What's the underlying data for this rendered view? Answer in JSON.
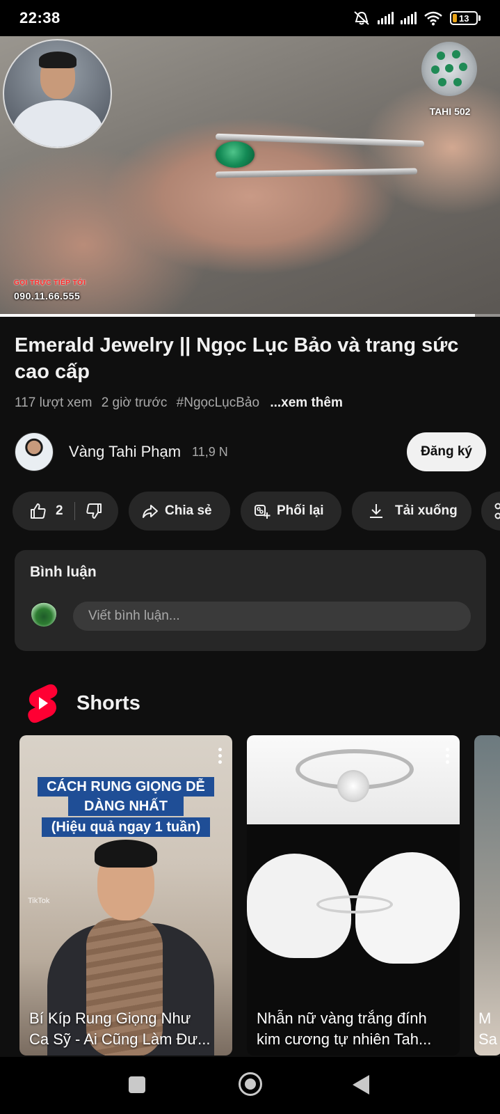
{
  "status_bar": {
    "time": "22:38",
    "battery": "13",
    "icons": [
      "mute-icon",
      "signal-icon",
      "signal-icon",
      "wifi-icon",
      "battery-icon"
    ]
  },
  "video": {
    "logo_text": "TAHI 502",
    "hotline_label": "GỌI TRỰC TIẾP TỚI",
    "hotline_number": "090.11.66.555",
    "progress": 0.95
  },
  "title": "Emerald Jewelry || Ngọc Lục Bảo và trang sức cao cấp",
  "meta": {
    "views": "117 lượt xem",
    "time_ago": "2 giờ trước",
    "hashtag": "#NgọcLụcBảo",
    "more": "...xem thêm"
  },
  "channel": {
    "name": "Vàng Tahi Phạm",
    "subscribers": "11,9 N",
    "subscribe_label": "Đăng ký"
  },
  "actions": {
    "like_count": "2",
    "share": "Chia sẻ",
    "remix": "Phối lại",
    "download": "Tải xuống"
  },
  "comments": {
    "title": "Bình luận",
    "placeholder": "Viết bình luận..."
  },
  "shorts": {
    "title": "Shorts",
    "items": [
      {
        "overlay_line1": "CÁCH RUNG GIỌNG DỄ",
        "overlay_line2": "DÀNG NHẤT",
        "overlay_line3": "(Hiệu quả ngay 1 tuần)",
        "watermark": "TikTok",
        "title_line1": "Bí Kíp Rung Giọng Như",
        "title_line2": "Ca Sỹ - Ai Cũng Làm Đư..."
      },
      {
        "title_line1": "Nhẫn nữ vàng trắng đính",
        "title_line2": "kim cương tự nhiên Tah..."
      },
      {
        "title_line1": "M",
        "title_line2": "Sa"
      }
    ]
  },
  "colors": {
    "background": "#0f0f0f",
    "chip": "#272727",
    "text": "#f1f1f1",
    "secondary_text": "#aaaaaa",
    "shorts_red": "#ff0033"
  }
}
